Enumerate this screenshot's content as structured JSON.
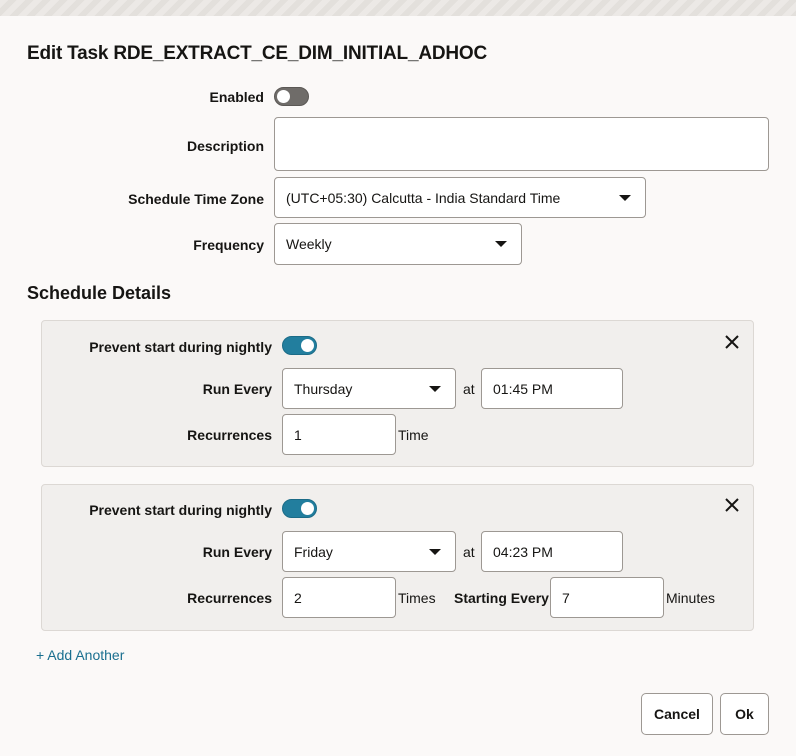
{
  "dialog": {
    "title": "Edit Task RDE_EXTRACT_CE_DIM_INITIAL_ADHOC"
  },
  "form": {
    "enabled_label": "Enabled",
    "enabled": false,
    "description_label": "Description",
    "description_value": "",
    "timezone_label": "Schedule Time Zone",
    "timezone_value": "(UTC+05:30) Calcutta - India Standard Time",
    "frequency_label": "Frequency",
    "frequency_value": "Weekly"
  },
  "schedule": {
    "title": "Schedule Details",
    "entries": [
      {
        "prevent_label": "Prevent start during nightly",
        "prevent_on": true,
        "run_every_label": "Run Every",
        "day": "Thursday",
        "at_label": "at",
        "time": "01:45 PM",
        "recurrences_label": "Recurrences",
        "recurrences": "1",
        "recurrence_unit": "Time"
      },
      {
        "prevent_label": "Prevent start during nightly",
        "prevent_on": true,
        "run_every_label": "Run Every",
        "day": "Friday",
        "at_label": "at",
        "time": "04:23 PM",
        "recurrences_label": "Recurrences",
        "recurrences": "2",
        "recurrence_unit": "Times",
        "starting_every_label": "Starting Every",
        "starting_every": "7",
        "starting_every_unit": "Minutes"
      }
    ],
    "add_another_label": "+ Add Another"
  },
  "buttons": {
    "cancel_label": "Cancel",
    "ok_label": "Ok"
  },
  "colors": {
    "accent": "#227e9e",
    "link": "#1a6f8f",
    "toggle_off": "#6f6c69"
  },
  "icons": {
    "close": "close-icon",
    "dropdown": "chevron-down-icon"
  }
}
